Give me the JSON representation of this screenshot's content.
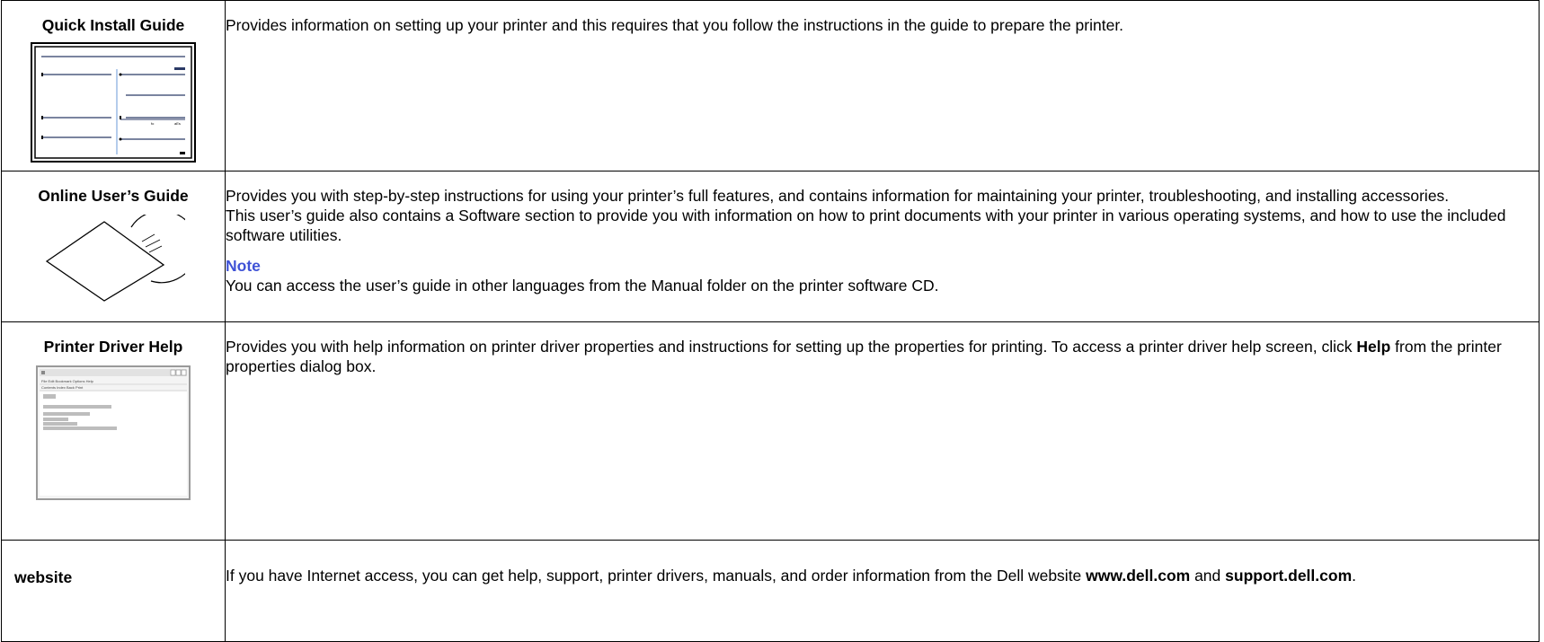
{
  "rows": [
    {
      "title": "Quick Install Guide",
      "text": "Provides information on setting up your printer and this requires that you follow the instructions in the guide to prepare the printer.",
      "image_icon": "quick-install-guide-thumbnail"
    },
    {
      "title": "Online User’s Guide",
      "para1": "Provides you with step-by-step instructions for using your printer’s full features, and contains information for maintaining your printer, troubleshooting, and installing accessories.",
      "para2": "This user’s guide also contains a Software section to provide you with information on how to print documents with your printer in various operating systems, and how to use the included software utilities.",
      "note_title": "Note",
      "note_text": "You can access the user’s guide in other languages from the Manual folder on the printer software CD.",
      "image_icon": "cd-sleeve-icon"
    },
    {
      "title": "Printer Driver Help",
      "text_before": "Provides you with help information on printer driver properties and instructions for setting up the properties for printing. To access a printer driver help screen, click ",
      "bold": "Help",
      "text_after": " from the printer properties dialog box.",
      "image_icon": "help-window-thumbnail"
    },
    {
      "title": "website",
      "text_before": "If you have Internet access, you can get help, support, printer drivers, manuals, and order information from the Dell website ",
      "link1": "www.dell.com",
      "and": " and ",
      "link2": "support.dell.com",
      "end": "."
    }
  ]
}
